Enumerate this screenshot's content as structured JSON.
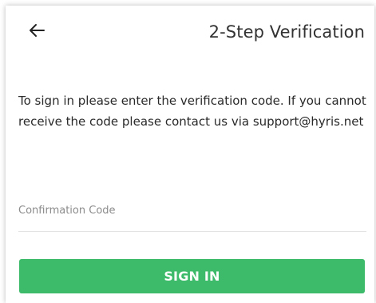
{
  "header": {
    "back_icon": "arrow-left-icon",
    "title": "2-Step Verification"
  },
  "message": {
    "text": "To sign in please enter the verification code. If you cannot receive the code please contact us via support@hyris.net"
  },
  "confirmation_field": {
    "placeholder": "Confirmation Code",
    "value": ""
  },
  "sign_in_button": {
    "label": "SIGN IN"
  },
  "colors": {
    "accent": "#3dbb6a",
    "text": "#2a2a2a",
    "placeholder": "#8c8c8c"
  }
}
